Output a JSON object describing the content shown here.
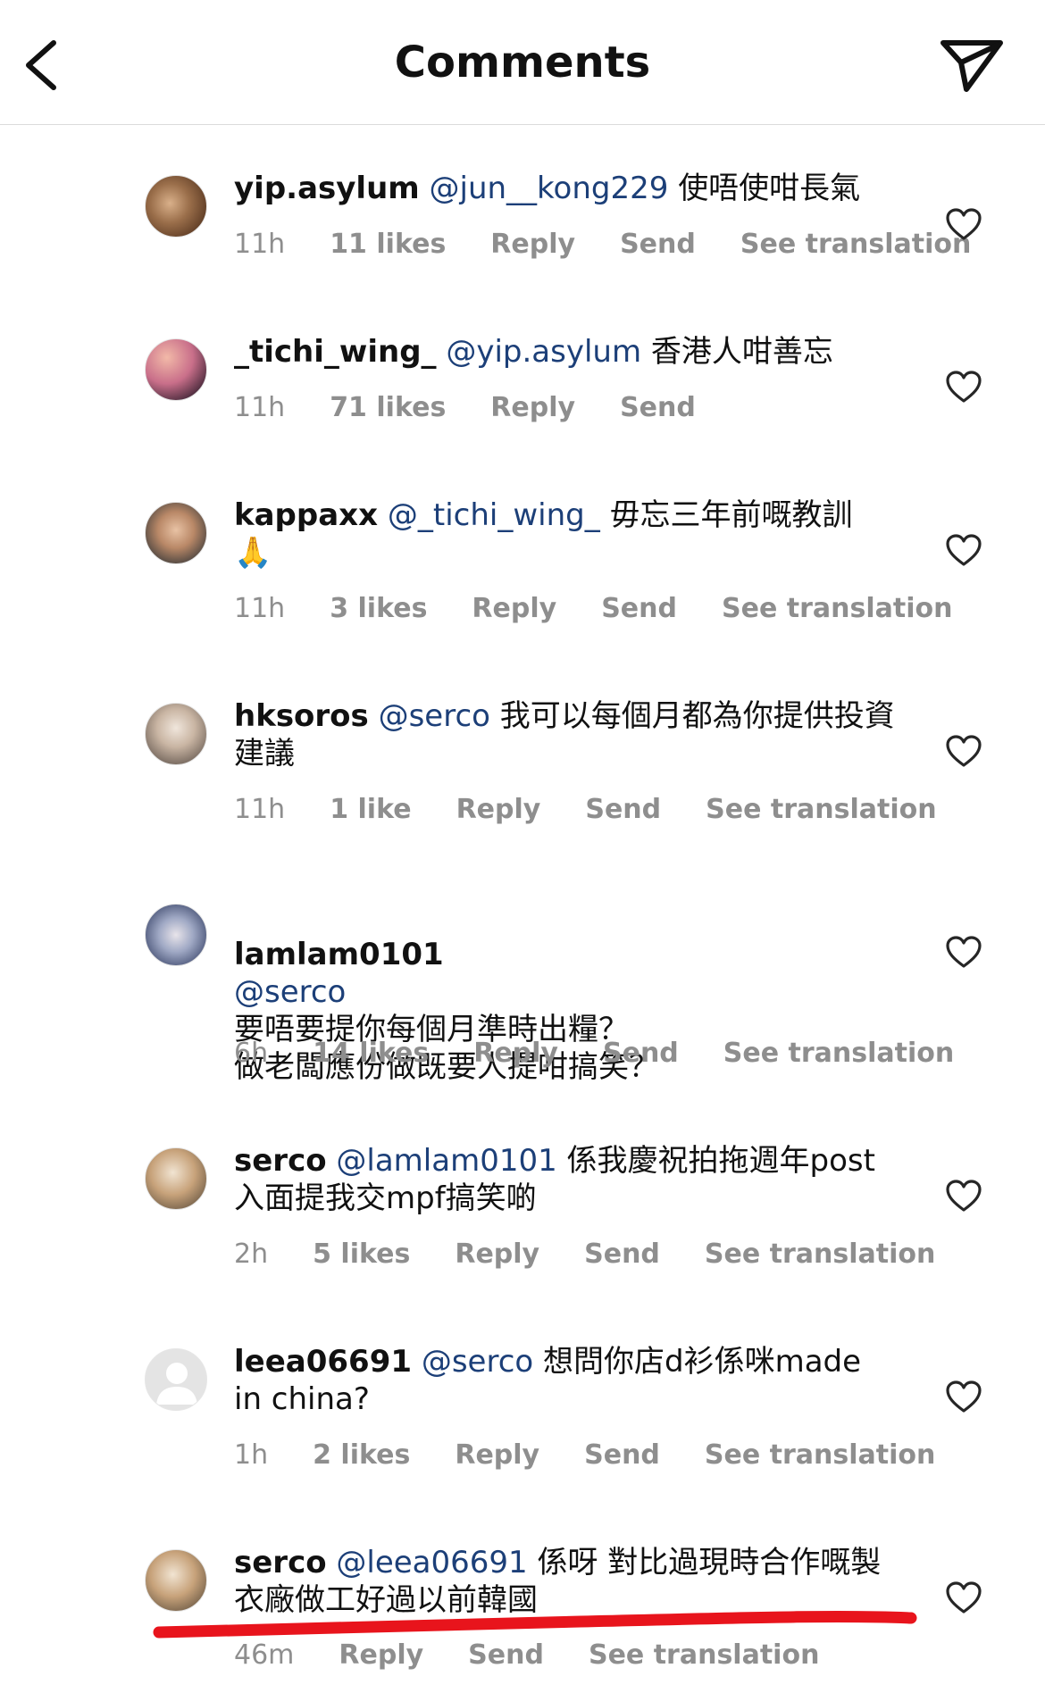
{
  "header": {
    "title": "Comments"
  },
  "comments": [
    {
      "username": "yip.asylum",
      "mention": "@jun__kong229",
      "text": "使唔使咁長氣",
      "time": "11h",
      "likes": "11 likes",
      "reply": "Reply",
      "send": "Send",
      "translation": "See translation"
    },
    {
      "username": "_tichi_wing_",
      "mention": "@yip.asylum",
      "text": "香港人咁善忘",
      "time": "11h",
      "likes": "71 likes",
      "reply": "Reply",
      "send": "Send",
      "translation": ""
    },
    {
      "username": "kappaxx",
      "mention": "@_tichi_wing_",
      "text": "毋忘三年前嘅教訓 🙏",
      "time": "11h",
      "likes": "3 likes",
      "reply": "Reply",
      "send": "Send",
      "translation": "See translation"
    },
    {
      "username": "hksoros",
      "mention": "@serco",
      "text": "我可以每個月都為你提供投資建議",
      "time": "11h",
      "likes": "1 like",
      "reply": "Reply",
      "send": "Send",
      "translation": "See translation"
    },
    {
      "username": "lamlam0101",
      "mention": "@serco",
      "text": "要唔要提你每個月準時出糧？\n做老闆應份做既要人提咁搞笑？",
      "time": "6h",
      "likes": "14 likes",
      "reply": "Reply",
      "send": "Send",
      "translation": "See translation"
    },
    {
      "username": "serco",
      "mention": "@lamlam0101",
      "text": "係我慶祝拍拖週年post入面提我交mpf搞笑啲",
      "time": "2h",
      "likes": "5 likes",
      "reply": "Reply",
      "send": "Send",
      "translation": "See translation"
    },
    {
      "username": "leea06691",
      "mention": "@serco",
      "text": "想問你店d衫係咪made in china?",
      "time": "1h",
      "likes": "2 likes",
      "reply": "Reply",
      "send": "Send",
      "translation": "See translation"
    },
    {
      "username": "serco",
      "mention": "@leea06691",
      "text": "係呀 對比過現時合作嘅製衣廠做工好過以前韓國",
      "time": "46m",
      "likes": "",
      "reply": "Reply",
      "send": "Send",
      "translation": "See translation"
    }
  ],
  "colors": {
    "mention": "#1c3f78",
    "meta": "#8e8e8e",
    "annotation": "#e8141c"
  },
  "icons": {
    "back": "chevron-left-icon",
    "send": "paper-plane-icon",
    "like": "heart-outline-icon"
  }
}
